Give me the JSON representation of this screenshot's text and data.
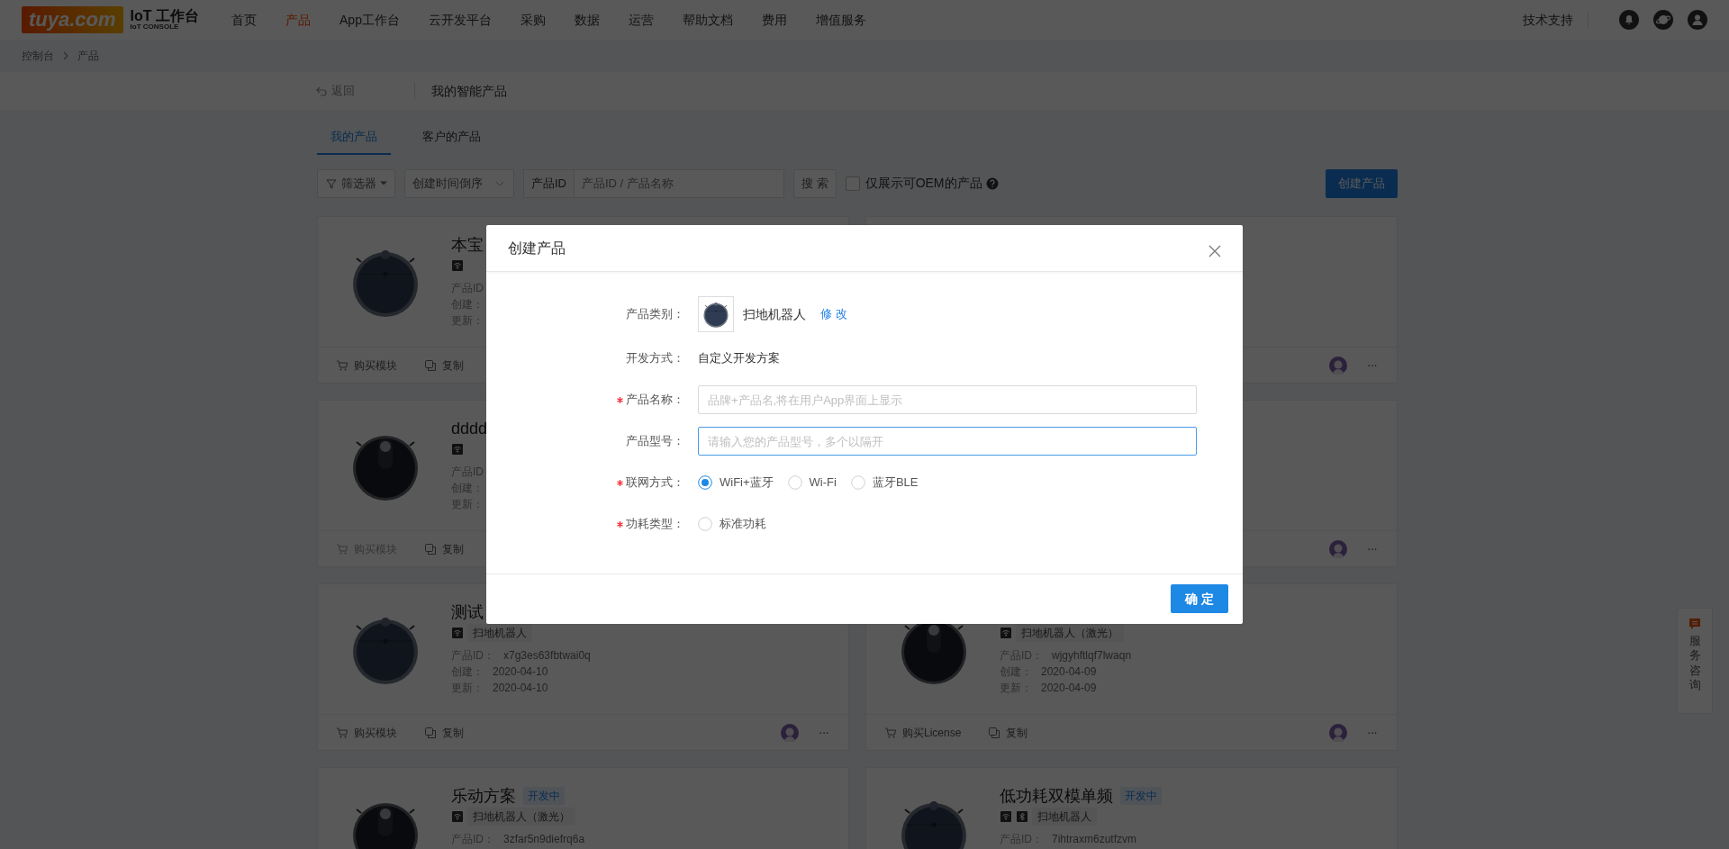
{
  "header": {
    "logo": "tuya.com",
    "title": "IoT 工作台",
    "subtitle": "IoT CONSOLE",
    "nav": [
      {
        "label": "首页",
        "selected": false
      },
      {
        "label": "产品",
        "selected": true
      },
      {
        "label": "App工作台",
        "selected": false
      },
      {
        "label": "云开发平台",
        "selected": false
      },
      {
        "label": "采购",
        "selected": false
      },
      {
        "label": "数据",
        "selected": false
      },
      {
        "label": "运营",
        "selected": false
      },
      {
        "label": "帮助文档",
        "selected": false
      },
      {
        "label": "费用",
        "selected": false
      },
      {
        "label": "增值服务",
        "selected": false
      }
    ],
    "support": "技术支持"
  },
  "breadcrumb": [
    "控制台",
    "产品"
  ],
  "subheader": {
    "back": "返回",
    "title": "我的智能产品"
  },
  "tabs": [
    {
      "label": "我的产品",
      "selected": true
    },
    {
      "label": "客户的产品",
      "selected": false
    }
  ],
  "toolbar": {
    "filter": "筛选器",
    "sort": "创建时间倒序",
    "id_label": "产品ID",
    "id_placeholder": "产品ID / 产品名称",
    "search": "搜 索",
    "oem_label": "仅展示可OEM的产品",
    "oem_checked": false,
    "create": "创建产品"
  },
  "cards": [
    {
      "kind": "standard",
      "title": "本宝",
      "icons": [
        {
          "kind": "wifi"
        }
      ],
      "fields": [
        {
          "label": "产品ID"
        },
        {
          "label": "创建："
        },
        {
          "label": "更新："
        }
      ],
      "actions": [
        {
          "kind": "buy",
          "label": "购买模块",
          "disabled": false
        },
        {
          "kind": "copy",
          "label": "复制",
          "disabled": false
        }
      ],
      "avatar": false
    },
    {
      "avatar": true,
      "more": "···"
    },
    {
      "kind": "laser",
      "title": "dddd",
      "icons": [
        {
          "kind": "wifi"
        }
      ],
      "fields": [
        {
          "label": "产品ID"
        },
        {
          "label": "创建："
        },
        {
          "label": "更新："
        }
      ],
      "actions": [
        {
          "kind": "buy",
          "label": "购买模块",
          "disabled": true
        },
        {
          "kind": "copy",
          "label": "复制",
          "disabled": false
        }
      ],
      "avatar": false
    },
    {
      "avatar": true,
      "more": "···"
    },
    {
      "kind": "standard",
      "title": "测试",
      "icons": [
        {
          "kind": "wifi"
        }
      ],
      "category": "扫地机器人",
      "fields": [
        {
          "label": "产品ID：",
          "value": "x7g3es63fbtwai0q"
        },
        {
          "label": "创建：",
          "value": "2020-04-10"
        },
        {
          "label": "更新：",
          "value": "2020-04-10"
        }
      ],
      "actions": [
        {
          "kind": "buy",
          "label": "购买模块",
          "disabled": false
        },
        {
          "kind": "copy",
          "label": "复制",
          "disabled": false
        }
      ],
      "avatar": true,
      "more": "···"
    },
    {
      "kind": "laser",
      "icons": [
        {
          "kind": "wifi"
        }
      ],
      "category": "扫地机器人（激光）",
      "fields": [
        {
          "label": "产品ID：",
          "value": "wjgyhftlqf7lwaqn"
        },
        {
          "label": "创建：",
          "value": "2020-04-09"
        },
        {
          "label": "更新：",
          "value": "2020-04-09"
        }
      ],
      "actions": [
        {
          "kind": "buy",
          "label": "购买License",
          "disabled": false
        },
        {
          "kind": "copy",
          "label": "复制",
          "disabled": false
        }
      ],
      "avatar": true,
      "more": "···"
    },
    {
      "kind": "laser",
      "title": "乐动方案",
      "status": "开发中",
      "icons": [
        {
          "kind": "wifi"
        }
      ],
      "category": "扫地机器人（激光）",
      "fields": [
        {
          "label": "产品ID：",
          "value": "3zfar5n9diefrq6a"
        }
      ]
    },
    {
      "kind": "standard",
      "title": "低功耗双模单频",
      "status": "开发中",
      "icons": [
        {
          "kind": "wifi"
        },
        {
          "kind": "bluetooth"
        }
      ],
      "category": "扫地机器人",
      "fields": [
        {
          "label": "产品ID：",
          "value": "7ihtraxm6zutfzvm"
        }
      ]
    }
  ],
  "service": "服务咨询",
  "modal": {
    "title": "创建产品",
    "fields": [
      {
        "kind": "category",
        "label": "产品类别：",
        "required": false,
        "value": "扫地机器人",
        "action": "修 改"
      },
      {
        "kind": "text",
        "label": "开发方式：",
        "required": false,
        "value": "自定义开发方案"
      },
      {
        "kind": "input",
        "label": "产品名称：",
        "required": true,
        "placeholder": "品牌+产品名,将在用户App界面上显示",
        "focused": false
      },
      {
        "kind": "input",
        "label": "产品型号：",
        "required": false,
        "placeholder": "请输入您的产品型号，多个以隔开",
        "focused": true
      },
      {
        "kind": "radio",
        "label": "联网方式：",
        "required": true,
        "options": [
          {
            "label": "WiFi+蓝牙",
            "selected": true
          },
          {
            "label": "Wi-Fi",
            "selected": false
          },
          {
            "label": "蓝牙BLE",
            "selected": false
          }
        ]
      },
      {
        "kind": "radio",
        "label": "功耗类型：",
        "required": true,
        "options": [
          {
            "label": "标准功耗",
            "selected": false
          }
        ]
      }
    ],
    "confirm": "确 定"
  }
}
